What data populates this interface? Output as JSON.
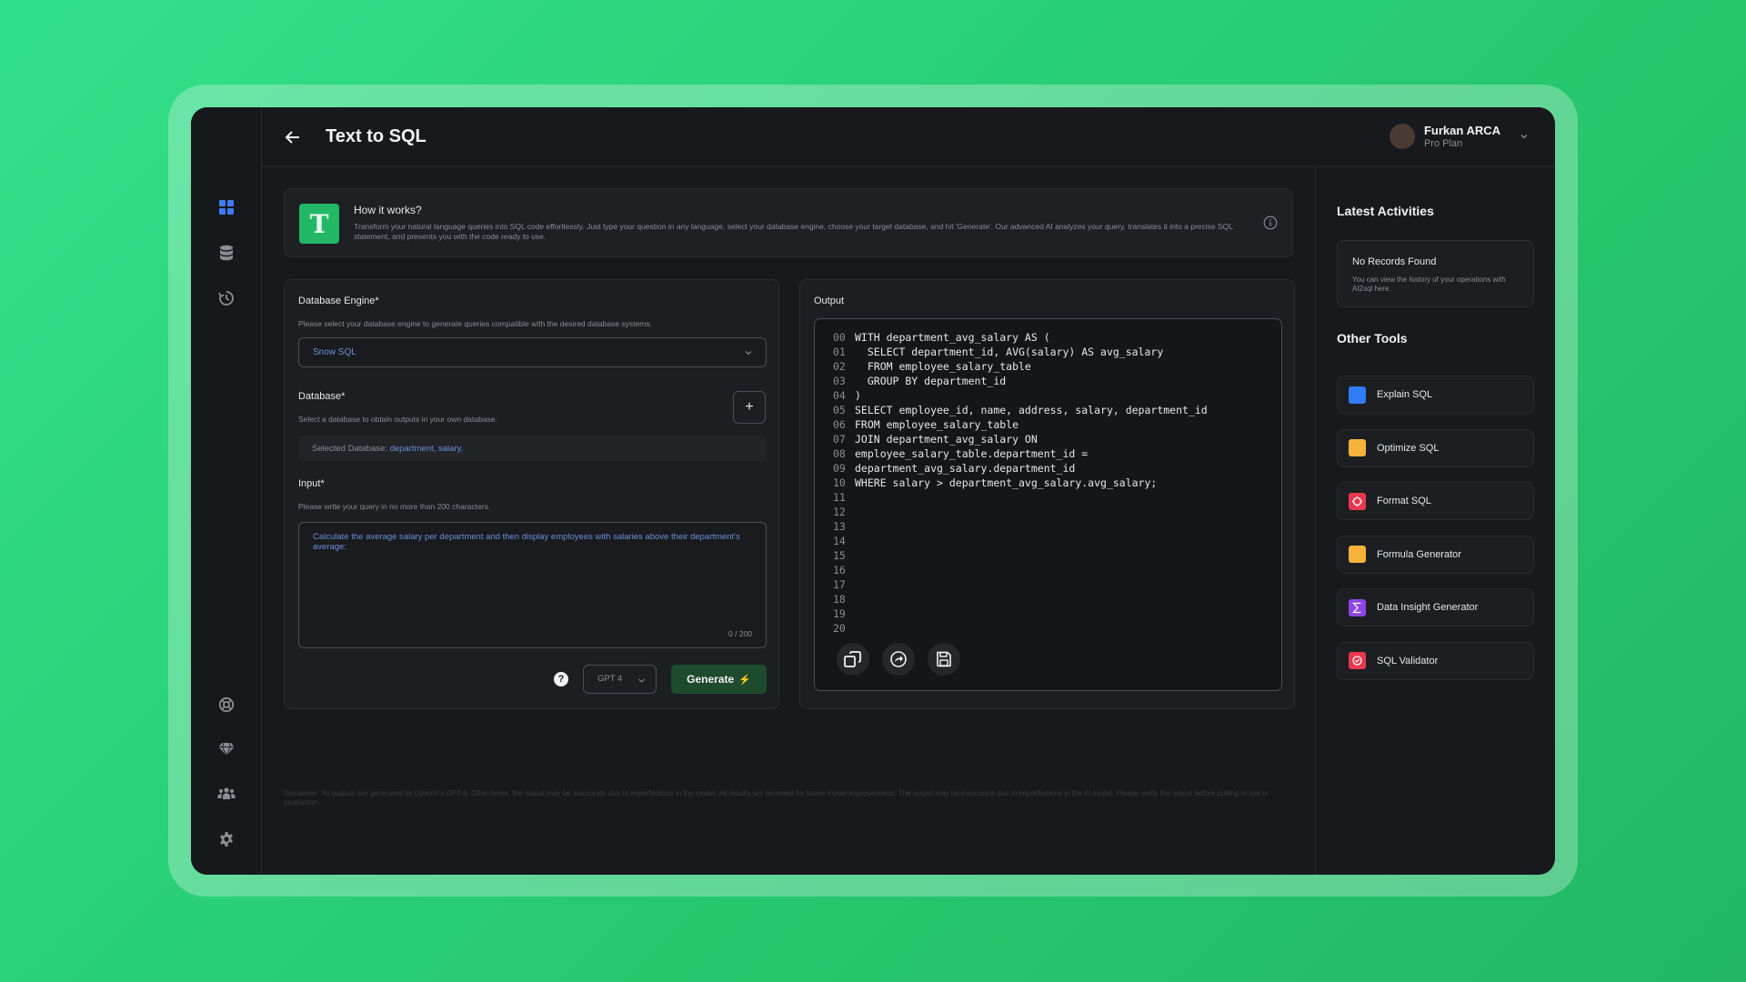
{
  "header": {
    "title": "Text to SQL",
    "user_name": "Furkan ARCA",
    "user_plan": "Pro Plan"
  },
  "how_it_works": {
    "badge": "T",
    "title": "How it works?",
    "text": "Transform your natural language queries into SQL code effortlessly. Just type your question in any language, select your database engine, choose your target database, and hit 'Generate'. Our advanced AI analyzes your query, translates it into a precise SQL statement, and presents you with the code ready to use."
  },
  "form": {
    "engine_label": "Database Engine*",
    "engine_hint": "Please select your database engine to generate queries compatible with the desired database systems.",
    "engine_value": "Snow SQL",
    "database_label": "Database*",
    "database_hint": "Select a database to obtain outputs in your own database.",
    "add_label": "+",
    "selected_db_prefix": "Selected Database: ",
    "selected_db_values": "department, salary,",
    "input_label": "Input*",
    "input_hint": "Please write your query in no more than 200 characters.",
    "input_value": "Calculate the average salary per department  and then display employees with salaries above their department's average:",
    "counter": "0 / 200",
    "help": "?",
    "model": "GPT 4",
    "generate_label": "Generate",
    "generate_bolt": "⚡"
  },
  "output": {
    "label": "Output",
    "lines": [
      {
        "n": "00",
        "code": "WITH department_avg_salary AS ("
      },
      {
        "n": "01",
        "code": "  SELECT department_id, AVG(salary) AS avg_salary"
      },
      {
        "n": "02",
        "code": "  FROM employee_salary_table"
      },
      {
        "n": "03",
        "code": "  GROUP BY department_id"
      },
      {
        "n": "04",
        "code": ")"
      },
      {
        "n": "05",
        "code": "SELECT employee_id, name, address, salary, department_id"
      },
      {
        "n": "06",
        "code": "FROM employee_salary_table"
      },
      {
        "n": "07",
        "code": "JOIN department_avg_salary ON"
      },
      {
        "n": "08",
        "code": "employee_salary_table.department_id ="
      },
      {
        "n": "09",
        "code": "department_avg_salary.department_id"
      },
      {
        "n": "10",
        "code": "WHERE salary > department_avg_salary.avg_salary;"
      },
      {
        "n": "11",
        "code": ""
      },
      {
        "n": "12",
        "code": ""
      },
      {
        "n": "13",
        "code": ""
      },
      {
        "n": "14",
        "code": ""
      },
      {
        "n": "15",
        "code": ""
      },
      {
        "n": "16",
        "code": ""
      },
      {
        "n": "17",
        "code": ""
      },
      {
        "n": "18",
        "code": ""
      },
      {
        "n": "19",
        "code": ""
      },
      {
        "n": "20",
        "code": ""
      }
    ]
  },
  "disclaimer": "Disclaimer: All outputs are generated by OpenAI's GPT-3. Often times, the output may be inaccurate due to imperfections in the model. All results are recorded for future model improvements. The output may be inaccurate due to imperfections in the AI model. Please verify the output before putting to use in production.",
  "right": {
    "activities_title": "Latest Activities",
    "no_records_title": "No Records Found",
    "no_records_text": "You can view the history of your operations with AI2sql here.",
    "tools_title": "Other Tools",
    "tools": [
      {
        "label": "Explain SQL",
        "icon": "explain-icon",
        "color": "#2f7cf6"
      },
      {
        "label": "Optimize SQL",
        "icon": "optimize-icon",
        "color": "#f7b338"
      },
      {
        "label": "Format SQL",
        "icon": "format-icon",
        "color": "#e8384f"
      },
      {
        "label": "Formula Generator",
        "icon": "formula-icon",
        "color": "#f7b338"
      },
      {
        "label": "Data Insight Generator",
        "icon": "insight-icon",
        "color": "#8e44e8"
      },
      {
        "label": "SQL Validator",
        "icon": "validator-icon",
        "color": "#e8384f"
      }
    ]
  },
  "colors": {
    "accent_blue": "#3d7cf0",
    "accent_green": "#22b866",
    "link_blue": "#6b8fd9"
  }
}
